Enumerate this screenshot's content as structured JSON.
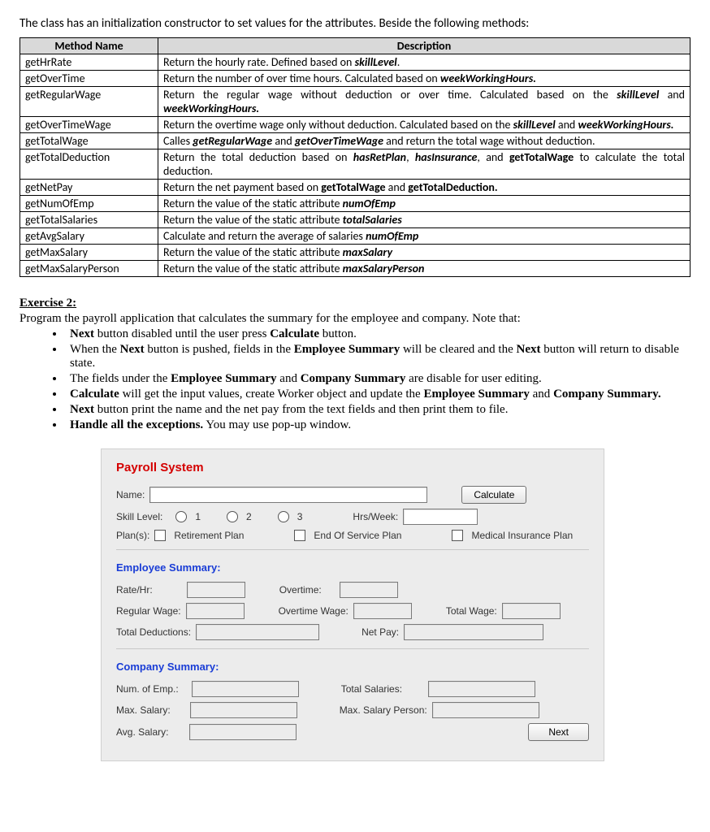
{
  "intro": "The class has an initialization constructor to set values for the attributes. Beside the following methods:",
  "table": {
    "headers": {
      "h1": "Method Name",
      "h2": "Description"
    },
    "rows": [
      {
        "name": "getHrRate",
        "desc_pre": "Return the hourly rate. Defined based on ",
        "k1": "skillLevel",
        "desc_post": "."
      },
      {
        "name": "getOverTime",
        "desc_pre": "Return the number of over time hours. Calculated based on ",
        "k1": "weekWorkingHours.",
        "desc_post": ""
      },
      {
        "name": "getRegularWage",
        "desc_pre": "Return the regular wage without deduction or over time. Calculated based on the ",
        "k1": "skillLevel",
        "desc_mid": " and ",
        "k2": "weekWorkingHours.",
        "desc_post": ""
      },
      {
        "name": "getOverTimeWage",
        "desc_pre": "Return the overtime wage only without deduction. Calculated based on the ",
        "k1": "skillLevel",
        "desc_mid": " and ",
        "k2": "weekWorkingHours.",
        "desc_post": ""
      },
      {
        "name": "getTotalWage",
        "desc_pre": "Calles ",
        "k1": "getRegularWage",
        "desc_mid": " and ",
        "k2": "getOverTimeWage",
        "desc_post": " and return the total wage without deduction."
      },
      {
        "name": "getTotalDeduction",
        "desc_pre": "Return the total deduction based on ",
        "k1": "hasRetPlan",
        "desc_mid": ", ",
        "k2": "hasInsurance",
        "desc_mid2": ", and ",
        "k3": "getTotalWage",
        "desc_post": " to calculate the total deduction."
      },
      {
        "name": "getNetPay",
        "desc_pre": "Return the net payment based on ",
        "k1": "getTotalWage",
        "desc_mid": " and ",
        "k2": "getTotalDeduction.",
        "desc_post": ""
      },
      {
        "name": "getNumOfEmp",
        "desc_pre": "Return the value of the static attribute ",
        "k1": "numOfEmp",
        "desc_post": ""
      },
      {
        "name": "getTotalSalaries",
        "desc_pre": "Return the value of the static attribute ",
        "k1": "totalSalaries",
        "desc_post": ""
      },
      {
        "name": "getAvgSalary",
        "desc_pre": "Calculate and return the average of salaries ",
        "k1": "numOfEmp",
        "desc_post": ""
      },
      {
        "name": "getMaxSalary",
        "desc_pre": "Return the value of the static attribute ",
        "k1": "maxSalary",
        "desc_post": ""
      },
      {
        "name": "getMaxSalaryPerson",
        "desc_pre": "Return the value of the static attribute ",
        "k1": "maxSalaryPerson",
        "desc_post": ""
      }
    ]
  },
  "exercise": {
    "title": "Exercise 2:",
    "intro": "Program the payroll application that calculates the summary for the employee and company. Note that:",
    "b1": {
      "a": "Next",
      "b": " button disabled until the user press ",
      "c": "Calculate",
      "d": " button."
    },
    "b2": {
      "a": "When the ",
      "b": "Next",
      "c": " button is pushed, fields in the ",
      "d": "Employee Summary",
      "e": " will be cleared and the ",
      "f": "Next",
      "g": " button will return to disable state."
    },
    "b3": {
      "a": "The fields under the ",
      "b": "Employee Summary",
      "c": " and ",
      "d": "Company Summary",
      "e": " are disable for user editing."
    },
    "b4": {
      "a": "Calculate",
      "b": " will get the input values, create Worker object and update the ",
      "c": "Employee Summary",
      "d": " and ",
      "e": "Company Summary.",
      "f": ""
    },
    "b5": {
      "a": "Next",
      "b": " button print the name and the net pay from the text fields and then print them to file."
    },
    "b6": {
      "a": "Handle all the exceptions.",
      "b": " You may use pop-up window."
    }
  },
  "form": {
    "title": "Payroll System",
    "name_label": "Name:",
    "calc_btn": "Calculate",
    "skill_label": "Skill Level:",
    "skill_opts": {
      "o1": "1",
      "o2": "2",
      "o3": "3"
    },
    "hrs_label": "Hrs/Week:",
    "plans_label": "Plan(s):",
    "plan_opts": {
      "p1": "Retirement Plan",
      "p2": "End Of Service Plan",
      "p3": "Medical Insurance Plan"
    },
    "emp_section": "Employee Summary:",
    "rate_label": "Rate/Hr:",
    "overtime_label": "Overtime:",
    "regwage_label": "Regular Wage:",
    "otwage_label": "Overtime Wage:",
    "totwage_label": "Total Wage:",
    "totded_label": "Total Deductions:",
    "netpay_label": "Net Pay:",
    "comp_section": "Company Summary:",
    "numemp_label": "Num. of Emp.:",
    "totsal_label": "Total Salaries:",
    "maxsal_label": "Max. Salary:",
    "maxper_label": "Max. Salary Person:",
    "avgsal_label": "Avg. Salary:",
    "next_btn": "Next"
  }
}
